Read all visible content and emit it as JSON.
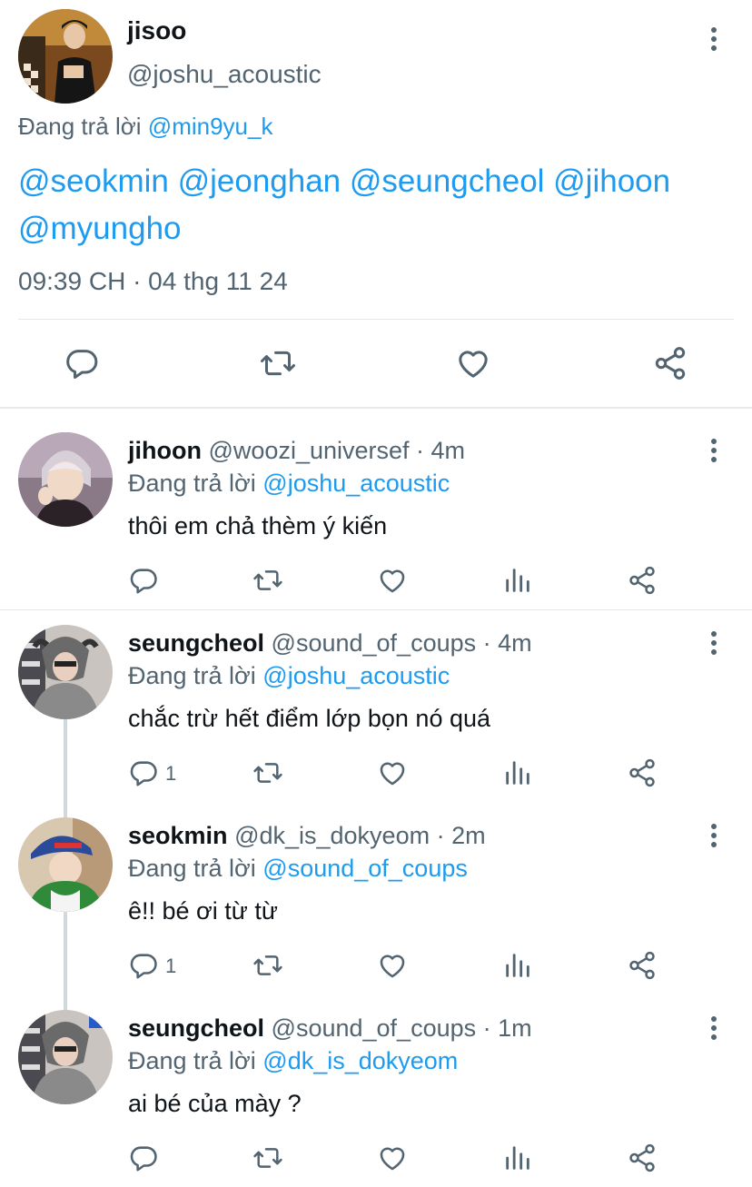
{
  "main_tweet": {
    "display_name": "jisoo",
    "handle": "@joshu_acoustic",
    "reply_prefix": "Đang trả lời",
    "reply_to": "@min9yu_k",
    "mentions_line1": "@seokmin @jeonghan @seungcheol @jihoon",
    "mentions_line2": "@myungho",
    "timestamp": "09:39 CH · 04 thg 11 24"
  },
  "replies": [
    {
      "display_name": "jihoon",
      "handle": "@woozi_universef",
      "time": "· 4m",
      "reply_prefix": "Đang trả lời",
      "reply_to": "@joshu_acoustic",
      "text": "thôi em chả thèm ý kiến",
      "reply_count": ""
    },
    {
      "display_name": "seungcheol",
      "handle": "@sound_of_coups",
      "time": "· 4m",
      "reply_prefix": "Đang trả lời",
      "reply_to": "@joshu_acoustic",
      "text": "chắc trừ hết điểm lớp bọn nó quá",
      "reply_count": "1"
    },
    {
      "display_name": "seokmin",
      "handle": "@dk_is_dokyeom",
      "time": "· 2m",
      "reply_prefix": "Đang trả lời",
      "reply_to": "@sound_of_coups",
      "text": "ê!! bé ơi từ từ",
      "reply_count": "1"
    },
    {
      "display_name": "seungcheol",
      "handle": "@sound_of_coups",
      "time": "· 1m",
      "reply_prefix": "Đang trả lời",
      "reply_to": "@dk_is_dokyeom",
      "text": "ai bé của mày ?",
      "reply_count": ""
    }
  ],
  "colors": {
    "link": "#1d9bf0",
    "secondary_text": "#536471",
    "divider": "#e7e9ea"
  },
  "icons": [
    "kebab-icon",
    "reply-icon",
    "retweet-icon",
    "like-icon",
    "views-icon",
    "share-icon"
  ]
}
